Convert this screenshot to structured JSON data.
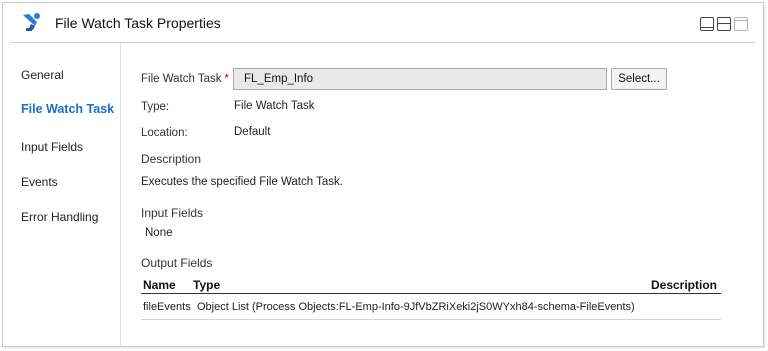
{
  "header": {
    "title": "File Watch Task Properties",
    "icon": "file-watch-task-icon"
  },
  "sidenav": {
    "items": [
      {
        "label": "General",
        "active": false
      },
      {
        "label": "File Watch Task",
        "active": true
      },
      {
        "label": "Input Fields",
        "active": false
      },
      {
        "label": "Events",
        "active": false
      },
      {
        "label": "Error Handling",
        "active": false
      }
    ]
  },
  "form": {
    "task_label": "File Watch Task",
    "required_marker": "*",
    "task_value": "FL_Emp_Info",
    "select_label": "Select...",
    "type_label": "Type:",
    "type_value": "File Watch Task",
    "location_label": "Location:",
    "location_value": "Default",
    "description_heading": "Description",
    "description_text": "Executes the specified File Watch Task.",
    "input_fields_heading": "Input Fields",
    "input_fields_value": "None",
    "output_fields_heading": "Output Fields"
  },
  "output_table": {
    "columns": [
      "Name",
      "Type",
      "Description"
    ],
    "rows": [
      {
        "name": "fileEvents",
        "type": "Object List (Process Objects:FL-Emp-Info-9JfVbZRiXeki2jS0WYxh84-schema-FileEvents)",
        "description": ""
      }
    ]
  },
  "colors": {
    "accent": "#1a6ec9",
    "required": "#cc0000",
    "input_bg": "#e9e9e9"
  }
}
